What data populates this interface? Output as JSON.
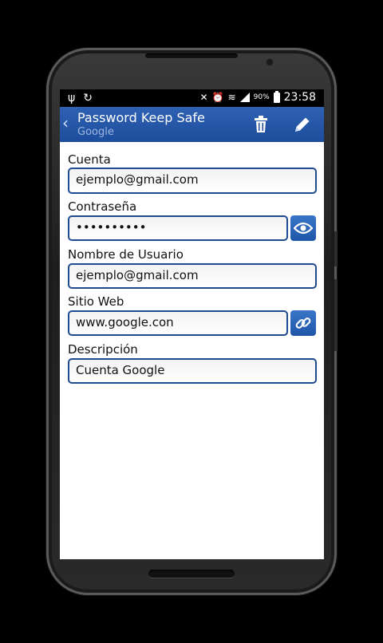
{
  "status_bar": {
    "battery_percent": "90%",
    "time": "23:58"
  },
  "action_bar": {
    "title": "Password Keep Safe",
    "subtitle": "Google",
    "delete_icon": "trash-icon",
    "edit_icon": "pencil-icon"
  },
  "form": {
    "account_label": "Cuenta",
    "account_value": "ejemplo@gmail.com",
    "password_label": "Contraseña",
    "password_value": "••••••••••",
    "username_label": "Nombre de Usuario",
    "username_value": "ejemplo@gmail.com",
    "website_label": "Sitio Web",
    "website_value": "www.google.con",
    "description_label": "Descripción",
    "description_value": "Cuenta Google"
  },
  "colors": {
    "action_bar": "#1d4d9c",
    "field_border": "#1f4a8f",
    "button": "#1f56a8"
  }
}
